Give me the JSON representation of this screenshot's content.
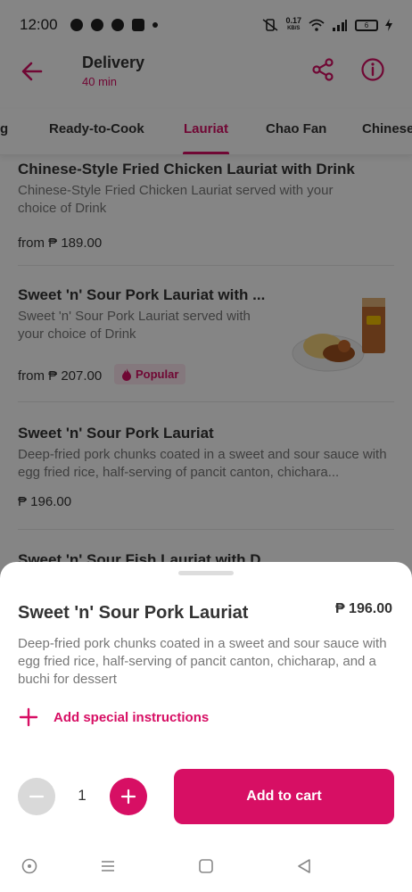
{
  "status_bar": {
    "time": "12:00",
    "net_speed_value": "0.17",
    "net_speed_unit": "KB/S",
    "battery": "6"
  },
  "header": {
    "title": "Delivery",
    "subtitle": "40 min"
  },
  "tabs": [
    {
      "label": "g"
    },
    {
      "label": "Ready-to-Cook"
    },
    {
      "label": "Lauriat",
      "active": true
    },
    {
      "label": "Chao Fan"
    },
    {
      "label": "Chinese"
    }
  ],
  "menu_items": [
    {
      "name": "Chinese-Style Fried Chicken Lauriat with Drink",
      "description": "Chinese-Style Fried Chicken Lauriat served with your choice of Drink",
      "price": "from ₱ 189.00"
    },
    {
      "name": "Sweet 'n' Sour Pork Lauriat with ...",
      "description": "Sweet 'n' Sour Pork Lauriat served with your choice of Drink",
      "price": "from ₱ 207.00",
      "badge": "Popular"
    },
    {
      "name": "Sweet 'n' Sour Pork Lauriat",
      "description": "Deep-fried pork chunks coated in a sweet and sour sauce with egg fried rice, half-serving of pancit canton, chichara...",
      "price": "₱ 196.00"
    },
    {
      "name": "Sweet 'n' Sour Fish Lauriat with D..."
    }
  ],
  "sheet": {
    "title": "Sweet 'n' Sour Pork Lauriat",
    "price": "₱ 196.00",
    "description": "Deep-fried pork chunks coated in a sweet and sour sauce with egg fried rice, half-serving of pancit canton, chicharap, and a buchi for dessert",
    "special_instructions": "Add special instructions",
    "quantity": "1",
    "add_to_cart": "Add to cart"
  },
  "colors": {
    "brand": "#d70f64",
    "badge_bg": "#fde6ef",
    "disabled": "#d9d9d9"
  },
  "icons": [
    "back-arrow-icon",
    "share-icon",
    "info-icon",
    "plus-icon",
    "minus-icon",
    "fire-icon",
    "home-circle-icon",
    "menu-lines-icon",
    "square-icon",
    "triangle-back-icon"
  ]
}
